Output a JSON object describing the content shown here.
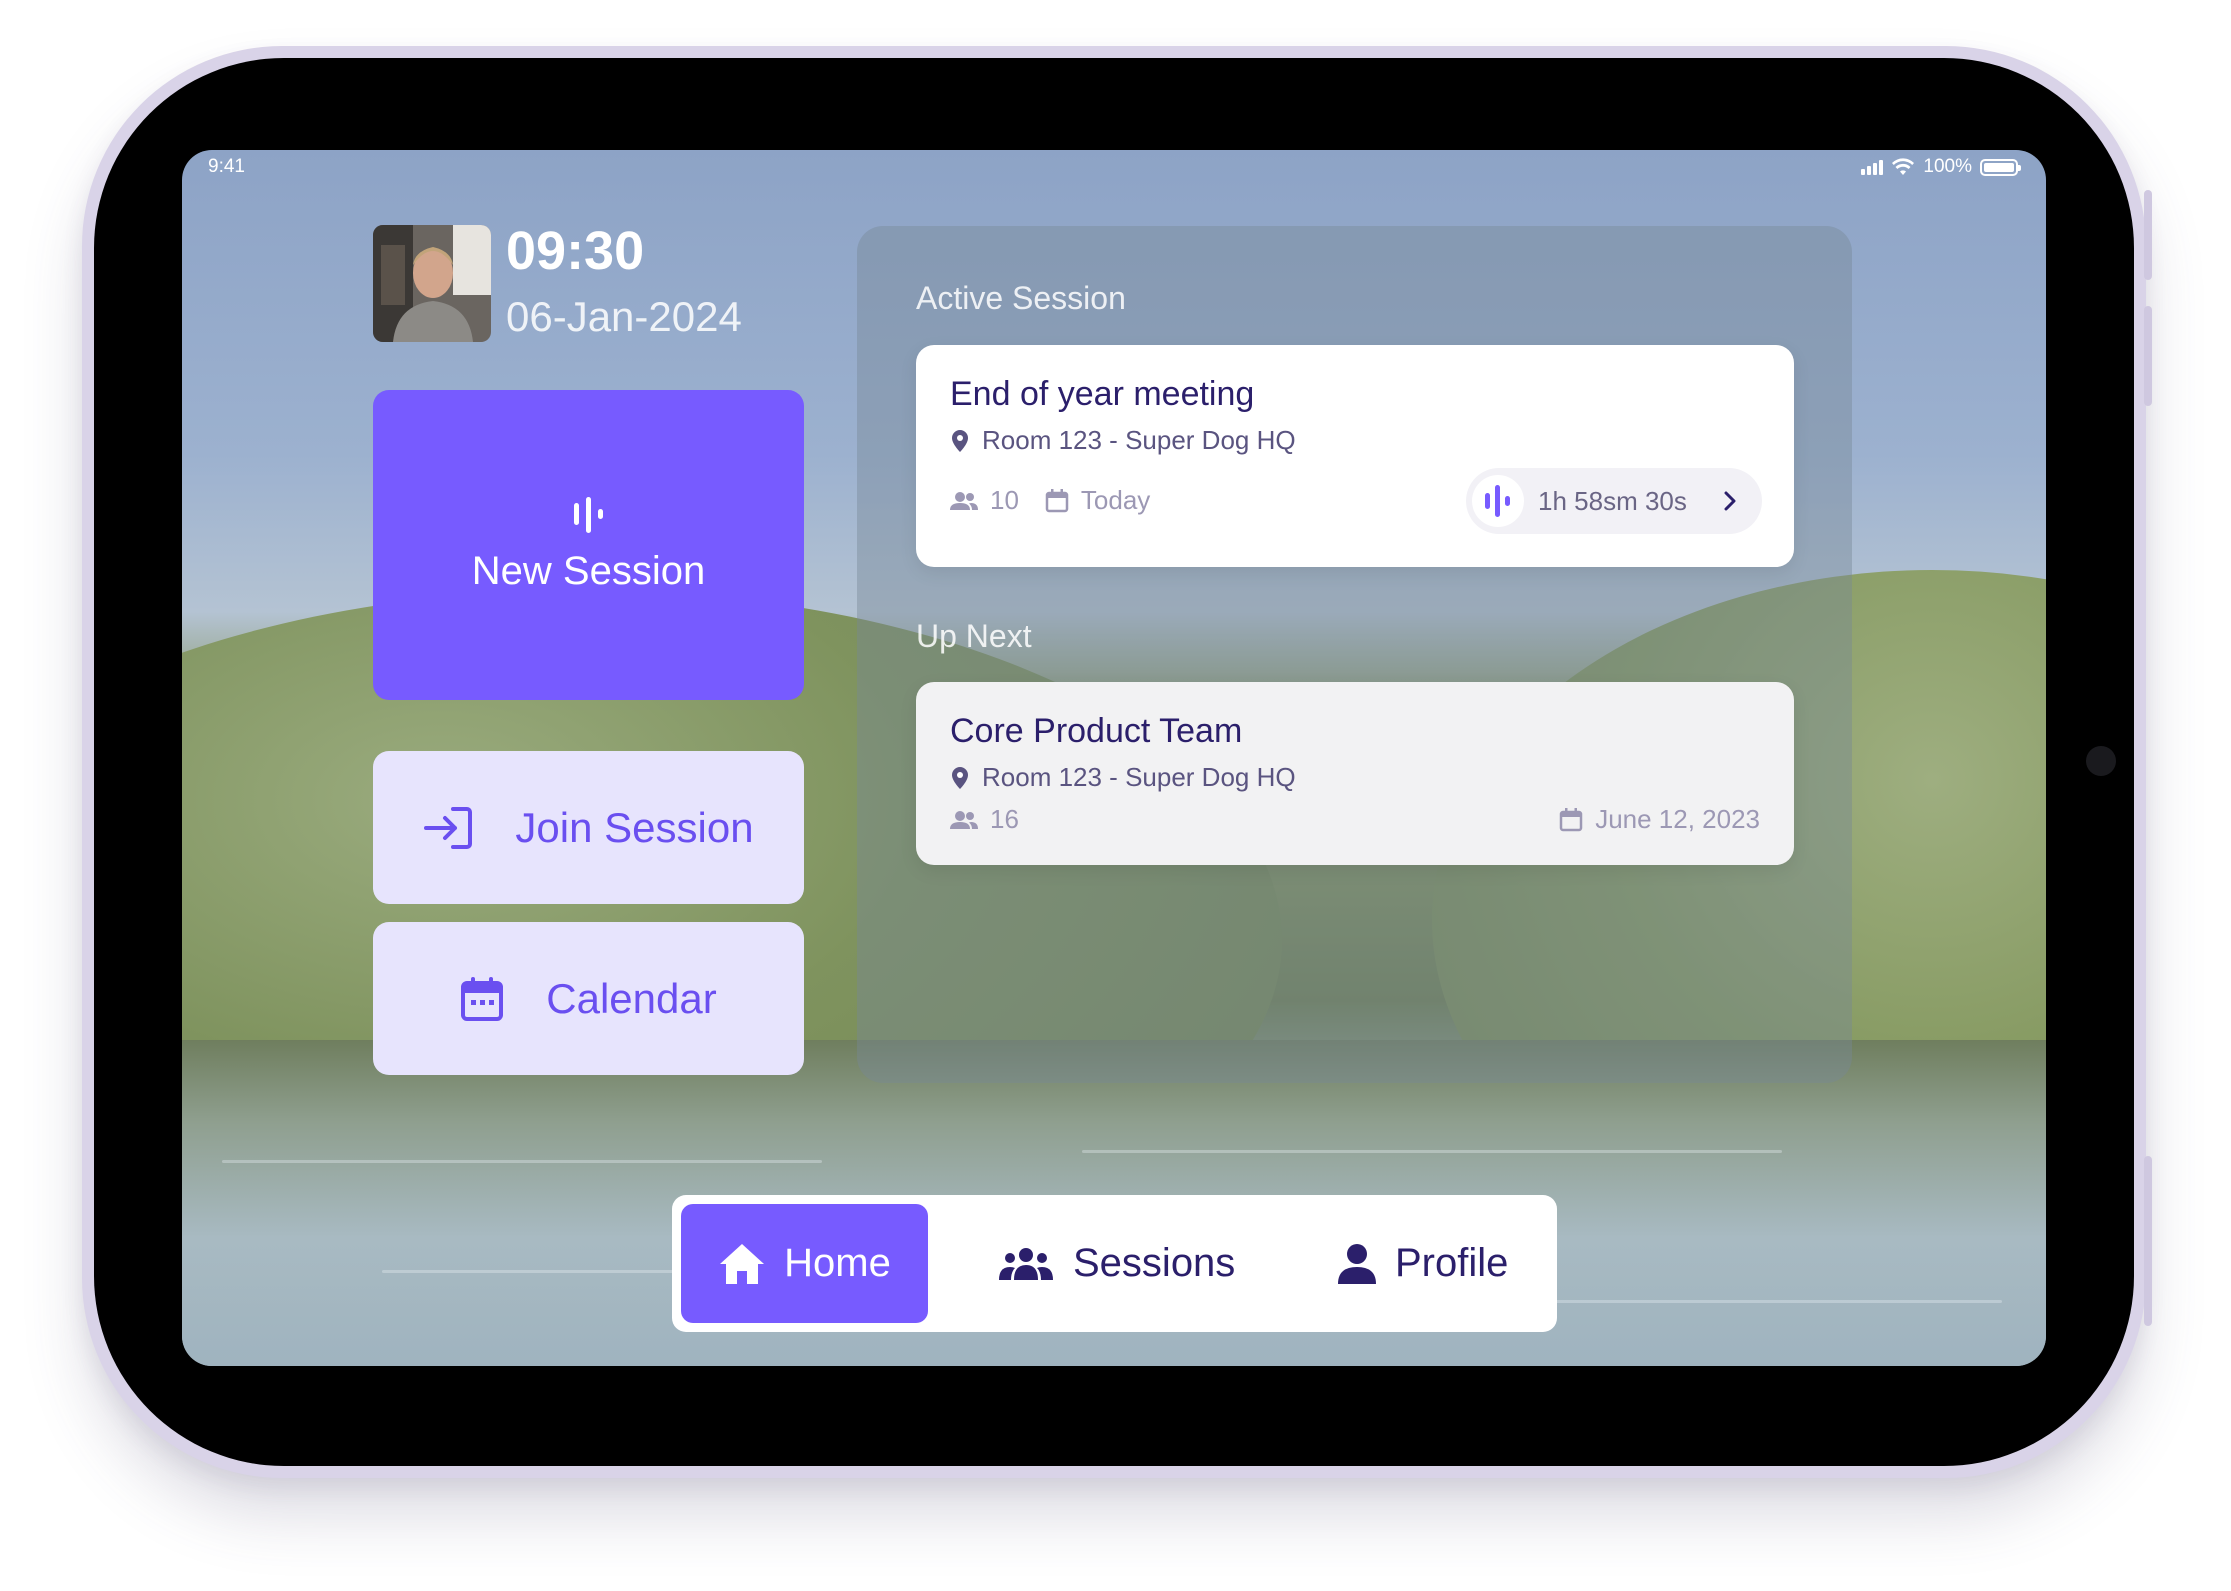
{
  "status_bar": {
    "time": "9:41",
    "battery": "100%"
  },
  "header": {
    "clock": "09:30",
    "date": "06-Jan-2024"
  },
  "actions": {
    "new_session": "New Session",
    "join_session": "Join Session",
    "calendar": "Calendar"
  },
  "active_session": {
    "section_label": "Active Session",
    "title": "End of year meeting",
    "location": "Room 123 - Super Dog HQ",
    "participants": "10",
    "date": "Today",
    "timer": "1h 58sm 30s"
  },
  "up_next": {
    "section_label": "Up Next",
    "title": "Core Product Team",
    "location": "Room 123 - Super Dog HQ",
    "participants": "16",
    "date": "June 12, 2023"
  },
  "nav": {
    "items": [
      {
        "label": "Home",
        "icon": "home-icon",
        "active": true
      },
      {
        "label": "Sessions",
        "icon": "group-icon",
        "active": false
      },
      {
        "label": "Profile",
        "icon": "person-icon",
        "active": false
      }
    ]
  },
  "colors": {
    "accent": "#775bff",
    "accent_light": "#e7e4fd",
    "title_text": "#2b1f6b"
  }
}
